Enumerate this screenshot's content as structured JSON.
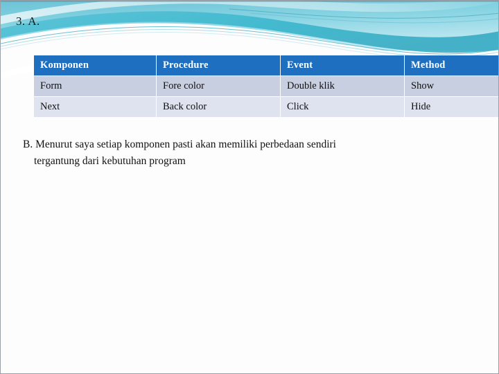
{
  "slide": {
    "heading": "3. A.",
    "background_color": "#fdfdfd",
    "accent_color": "#1f6fc0",
    "wave_color_light": "#8fd9e6",
    "wave_color_teal": "#3fb8cc",
    "wave_color_deep": "#2a93ab"
  },
  "table": {
    "headers": [
      "Komponen",
      "Procedure",
      "Event",
      "Method"
    ],
    "rows": [
      [
        "Form",
        "Fore color",
        "Double klik",
        "Show"
      ],
      [
        "Next",
        "Back color",
        "Click",
        "Hide"
      ]
    ],
    "header_bg": "#1f6fc0",
    "header_text_color": "#ffffff",
    "row_bg_odd": "#c8cfe0",
    "row_bg_even": "#dfe3ef"
  },
  "body": {
    "line1": "B. Menurut saya setiap komponen pasti akan memiliki perbedaan sendiri",
    "line2": "tergantung dari kebutuhan program"
  }
}
